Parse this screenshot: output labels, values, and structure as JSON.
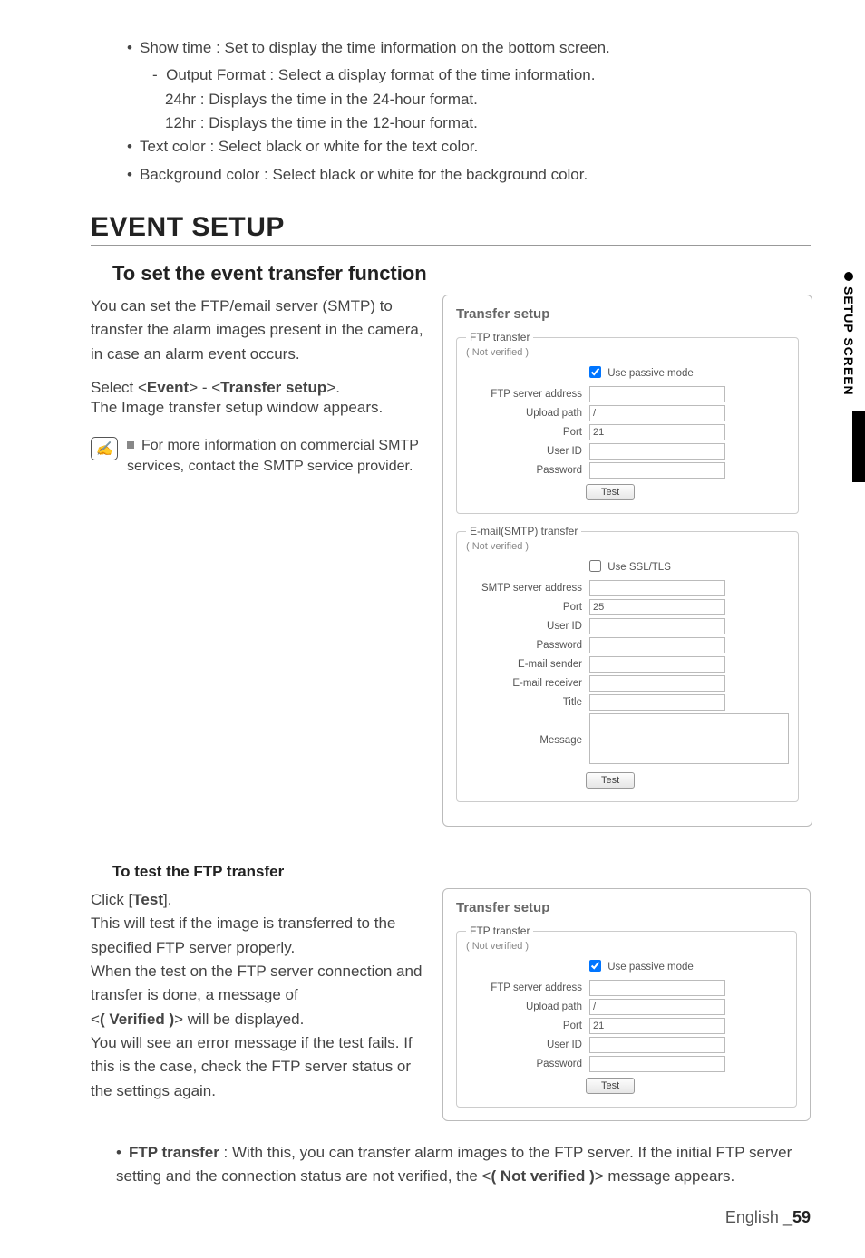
{
  "side": {
    "label": "SETUP SCREEN"
  },
  "top_bullets": {
    "b1": "Show time : Set to display the time information on the bottom screen.",
    "b1_sub": "Output Format : Select a display format of the time information.",
    "b1_sub_a": "24hr : Displays the time in the 24-hour format.",
    "b1_sub_b": "12hr : Displays the time in the 12-hour format.",
    "b2": "Text color : Select black or white for the text color.",
    "b3": "Background color : Select black or white for the background color."
  },
  "section_title": "EVENT SETUP",
  "subsection_title": "To set the event transfer function",
  "intro_p1": "You can set the FTP/email server (SMTP) to transfer the alarm images present in the camera, in case an alarm event occurs.",
  "nav_prefix": "Select <",
  "nav_event": "Event",
  "nav_mid": "> - <",
  "nav_ts": "Transfer setup",
  "nav_suffix": ">.",
  "nav_line2": "The Image transfer setup window appears.",
  "note_text": "For more information on commercial SMTP services, contact the SMTP service provider.",
  "panel1": {
    "title": "Transfer setup",
    "ftp": {
      "legend": "FTP transfer",
      "status": "( Not verified )",
      "passive_label": "Use passive mode",
      "passive_checked": true,
      "addr_label": "FTP server address",
      "addr_value": "",
      "upload_label": "Upload path",
      "upload_value": "/",
      "port_label": "Port",
      "port_value": "21",
      "user_label": "User ID",
      "user_value": "",
      "pass_label": "Password",
      "pass_value": "",
      "test_label": "Test"
    },
    "smtp": {
      "legend": "E-mail(SMTP) transfer",
      "status": "( Not verified )",
      "ssl_label": "Use SSL/TLS",
      "ssl_checked": false,
      "addr_label": "SMTP server address",
      "addr_value": "",
      "port_label": "Port",
      "port_value": "25",
      "user_label": "User ID",
      "user_value": "",
      "pass_label": "Password",
      "pass_value": "",
      "sender_label": "E-mail sender",
      "sender_value": "",
      "receiver_label": "E-mail receiver",
      "receiver_value": "",
      "title_label": "Title",
      "title_value": "",
      "message_label": "Message",
      "message_value": "",
      "test_label": "Test"
    }
  },
  "test_heading": "To test the FTP transfer",
  "test_p_pre": "Click [",
  "test_p_btn": "Test",
  "test_p_post": "].",
  "test_p2": "This will test if the image is transferred to the specified FTP server properly.",
  "test_p3a": "When the test on the FTP server connection and transfer is done, a message of",
  "test_p3b_pre": "<",
  "test_p3b_bold": "( Verified )",
  "test_p3b_post": "> will be displayed.",
  "test_p4": "You will see an error message if the test fails. If this is the case, check the FTP server status or the settings again.",
  "panel2": {
    "title": "Transfer setup",
    "ftp": {
      "legend": "FTP transfer",
      "status": "( Not verified )",
      "passive_label": "Use passive mode",
      "passive_checked": true,
      "addr_label": "FTP server address",
      "addr_value": "",
      "upload_label": "Upload path",
      "upload_value": "/",
      "port_label": "Port",
      "port_value": "21",
      "user_label": "User ID",
      "user_value": "",
      "pass_label": "Password",
      "pass_value": "",
      "test_label": "Test"
    }
  },
  "ftp_bullet_pre": "",
  "ftp_bullet_bold": "FTP transfer",
  "ftp_bullet_rest": " : With this, you can transfer alarm images to the FTP server. If the initial FTP server setting and the connection status are not verified, the <",
  "ftp_bullet_nv": "( Not verified )",
  "ftp_bullet_end": "> message appears.",
  "footer_lang": "English",
  "footer_page": "59"
}
